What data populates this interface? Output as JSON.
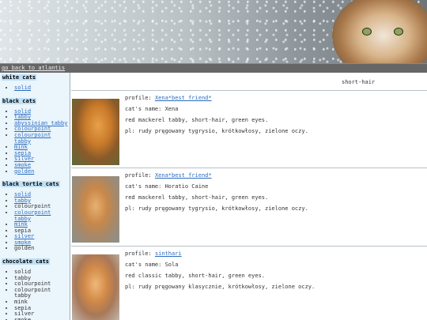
{
  "header": {
    "back_link": "go back to atlantis"
  },
  "sidebar": {
    "sections": [
      {
        "title": "white cats",
        "items": [
          {
            "label": "solid",
            "link": true
          }
        ]
      },
      {
        "title": "black cats",
        "items": [
          {
            "label": "solid",
            "link": true
          },
          {
            "label": "tabby",
            "link": true
          },
          {
            "label": "abyssinian tabby",
            "link": true
          },
          {
            "label": "colourpoint",
            "link": true
          },
          {
            "label": "colourpoint tabby",
            "link": true
          },
          {
            "label": "mink",
            "link": true
          },
          {
            "label": "sepia",
            "link": true
          },
          {
            "label": "silver",
            "link": true
          },
          {
            "label": "smoke",
            "link": true
          },
          {
            "label": "golden",
            "link": true
          }
        ]
      },
      {
        "title": "black tortie cats",
        "items": [
          {
            "label": "solid",
            "link": true
          },
          {
            "label": "tabby",
            "link": true
          },
          {
            "label": "colourpoint",
            "link": false
          },
          {
            "label": "colourpoint tabby",
            "link": true
          },
          {
            "label": "mink",
            "link": true
          },
          {
            "label": "sepia",
            "link": false
          },
          {
            "label": "silver",
            "link": true
          },
          {
            "label": "smoke",
            "link": true
          },
          {
            "label": "golden",
            "link": false
          }
        ]
      },
      {
        "title": "chocolate cats",
        "items": [
          {
            "label": "solid",
            "link": false
          },
          {
            "label": "tabby",
            "link": false
          },
          {
            "label": "colourpoint",
            "link": false
          },
          {
            "label": "colourpoint tabby",
            "link": false
          },
          {
            "label": "mink",
            "link": false
          },
          {
            "label": "sepia",
            "link": false
          },
          {
            "label": "silver",
            "link": false
          },
          {
            "label": "smoke",
            "link": false
          }
        ]
      }
    ]
  },
  "main": {
    "heading": "short-hair",
    "entries": [
      {
        "profile_label": "profile:",
        "profile_link": "Xena*best friend*",
        "name_line": "cat's name: Xena",
        "desc_en": "red mackerel tabby, short-hair, green eyes.",
        "desc_pl": "pl: rudy pręgowany tygrysio, krótkowłosy, zielone oczy."
      },
      {
        "profile_label": "profile:",
        "profile_link": "Xena*best friend*",
        "name_line": "cat's name: Horatio Caine",
        "desc_en": "red mackerel tabby, short-hair, green eyes.",
        "desc_pl": "pl: rudy pręgowany tygrysio, krótkowłosy, zielone oczy."
      },
      {
        "profile_label": "profile:",
        "profile_link": "sinthari",
        "name_line": "cat's name: Sola",
        "desc_en": "red classic tabby, short-hair, green eyes.",
        "desc_pl": "pl: rudy pręgowany klasycznie, krótkowłosy, zielone oczy."
      }
    ]
  }
}
